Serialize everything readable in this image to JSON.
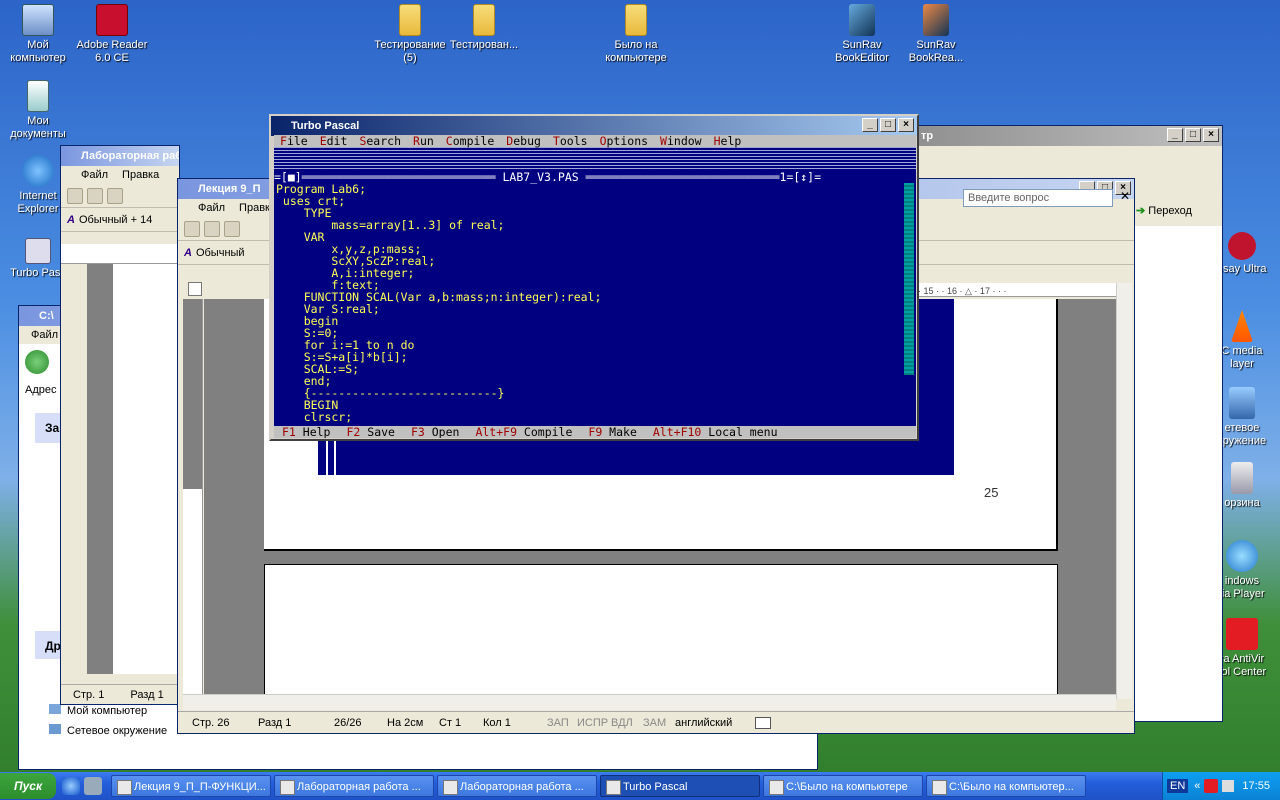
{
  "desktop": {
    "icons": [
      {
        "name": "my-computer",
        "label": "Мой\nкомпьютер"
      },
      {
        "name": "adobe-reader",
        "label": "Adobe Reader\n6.0 CE"
      },
      {
        "name": "my-documents",
        "label": "Мои\nдокументы"
      },
      {
        "name": "internet-explorer",
        "label": "Internet\nExplorer"
      },
      {
        "name": "turbo-pascal-shortcut",
        "label": "Turbo Pasc"
      },
      {
        "name": "folder-testing-5",
        "label": "Тестирование\n(5)"
      },
      {
        "name": "folder-testing",
        "label": "Тестирован..."
      },
      {
        "name": "folder-was-on-computer",
        "label": "Было на\nкомпьютере"
      },
      {
        "name": "sunrav-bookeditor",
        "label": "SunRav\nBookEditor"
      },
      {
        "name": "sunrav-bookreader",
        "label": "SunRav\nBookRea..."
      },
      {
        "name": "assay-ultra",
        "label": "ssay Ultra"
      },
      {
        "name": "vlc-media-player",
        "label": "C media\nlayer"
      },
      {
        "name": "network-places",
        "label": "етевое\nкружение"
      },
      {
        "name": "recycle-bin",
        "label": "орзина"
      },
      {
        "name": "windows-media-player",
        "label": "indows\nlia Player"
      },
      {
        "name": "avira",
        "label": "ra AntiVir\nrol Center"
      }
    ]
  },
  "explorer": {
    "title": "C:\\",
    "menu_file": "Файл",
    "address": "Адрес",
    "panel1": "За",
    "panel2": "Др",
    "items": [
      "Мой компьютер",
      "Сетевое окружение"
    ]
  },
  "word_lab": {
    "title": "Лабораторная работа № 6.doc",
    "menu": [
      "Файл",
      "Правка"
    ],
    "style": "Обычный + 14",
    "status": [
      "Стр. 1",
      "Разд 1"
    ]
  },
  "word_lec": {
    "title": "Лекция 9_П",
    "menu": [
      "Файл",
      "Правк"
    ],
    "style": "Обычный",
    "page_num": "25",
    "status": {
      "page": "Стр. 26",
      "section": "Разд 1",
      "pages": "26/26",
      "at": "На 2см",
      "line": "Ст 1",
      "col": "Кол 1",
      "rec": "ЗАП",
      "trk": "ИСПР",
      "ext": "ВДЛ",
      "ovr": "ЗАМ",
      "lang": "английский"
    }
  },
  "word_back": {
    "title_frag": "тр",
    "ask_placeholder": "Введите вопрос",
    "goto": "Переход",
    "ruler_ticks": "· 15 · · 16 · △ · 17 · · ·"
  },
  "turbo_pascal": {
    "title": "Turbo Pascal",
    "menu": [
      {
        "hk": "F",
        "rest": "ile"
      },
      {
        "hk": "E",
        "rest": "dit"
      },
      {
        "hk": "S",
        "rest": "earch"
      },
      {
        "hk": "R",
        "rest": "un"
      },
      {
        "hk": "C",
        "rest": "ompile"
      },
      {
        "hk": "D",
        "rest": "ebug"
      },
      {
        "hk": "T",
        "rest": "ools"
      },
      {
        "hk": "O",
        "rest": "ptions"
      },
      {
        "hk": "W",
        "rest": "indow"
      },
      {
        "hk": "H",
        "rest": "elp"
      }
    ],
    "frame_left": "=[■]",
    "file_name": " LAB7_V3.PAS ",
    "frame_right": "1=[↕]=",
    "code": [
      "Program Lab6;",
      " uses crt;",
      "    TYPE",
      "        mass=array[1..3] of real;",
      "    VAR",
      "        x,y,z,p:mass;",
      "        ScXY,ScZP:real;",
      "        A,i:integer;",
      "        f:text;",
      "    FUNCTION SCAL(Var a,b:mass;n:integer):real;",
      "    Var S:real;",
      "    begin",
      "    S:=0;",
      "    for i:=1 to n do",
      "    S:=S+a[i]*b[i];",
      "    SCAL:=S;",
      "    end;",
      "    {---------------------------}",
      "    BEGIN",
      "    clrscr;"
    ],
    "status": [
      {
        "hk": "F1",
        "label": " Help"
      },
      {
        "hk": "F2",
        "label": " Save"
      },
      {
        "hk": "F3",
        "label": " Open"
      },
      {
        "hk": "Alt+F9",
        "label": " Compile"
      },
      {
        "hk": "F9",
        "label": " Make"
      },
      {
        "hk": "Alt+F10",
        "label": " Local menu"
      }
    ]
  },
  "taskbar": {
    "start": "Пуск",
    "tasks": [
      "Лекция 9_П_П-ФУНКЦИ...",
      "Лабораторная работа ...",
      "Лабораторная работа ...",
      "Turbo Pascal",
      "C:\\Было на компьютере",
      "C:\\Было на компьютер..."
    ],
    "lang": "EN",
    "clock": "17:55"
  },
  "colors": {
    "tp_background": "#000080",
    "tp_code": "#ffff55",
    "tp_hotkey": "#a00000",
    "xp_taskbar": "#245edb"
  }
}
